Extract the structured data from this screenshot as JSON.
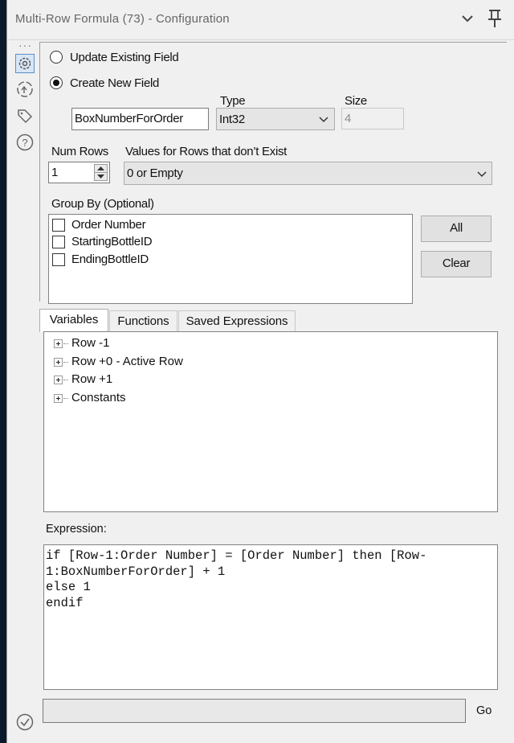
{
  "window": {
    "title": "Multi-Row Formula (73) - Configuration"
  },
  "sidebar": {
    "icons": [
      "gear-icon",
      "tag-icon",
      "help-icon",
      "check-icon"
    ]
  },
  "config": {
    "update_existing_label": "Update Existing Field",
    "create_new_label": "Create New  Field",
    "selected_option": "create_new",
    "field_name": "BoxNumberForOrder",
    "type_label": "Type",
    "type_value": "Int32",
    "size_label": "Size",
    "size_value": "4",
    "num_rows_label": "Num Rows",
    "num_rows_value": "1",
    "values_label": "Values for Rows that don’t Exist",
    "values_value": "0 or Empty",
    "group_by_label": "Group By (Optional)",
    "group_by_items": [
      {
        "label": "Order Number",
        "checked": false
      },
      {
        "label": "StartingBottleID",
        "checked": false
      },
      {
        "label": "EndingBottleID",
        "checked": false
      }
    ],
    "all_button": "All",
    "clear_button": "Clear"
  },
  "tabs": [
    {
      "label": "Variables",
      "active": true
    },
    {
      "label": "Functions",
      "active": false
    },
    {
      "label": "Saved Expressions",
      "active": false
    }
  ],
  "tree_items": [
    "Row -1",
    "Row +0 - Active Row",
    "Row +1",
    "Constants"
  ],
  "expression": {
    "label": "Expression:",
    "lines": [
      "if [Row-1:Order Number] = [Order Number] then [Row-",
      "1:BoxNumberForOrder] + 1",
      "else 1",
      "endif"
    ]
  },
  "footer": {
    "go_label": "Go"
  }
}
